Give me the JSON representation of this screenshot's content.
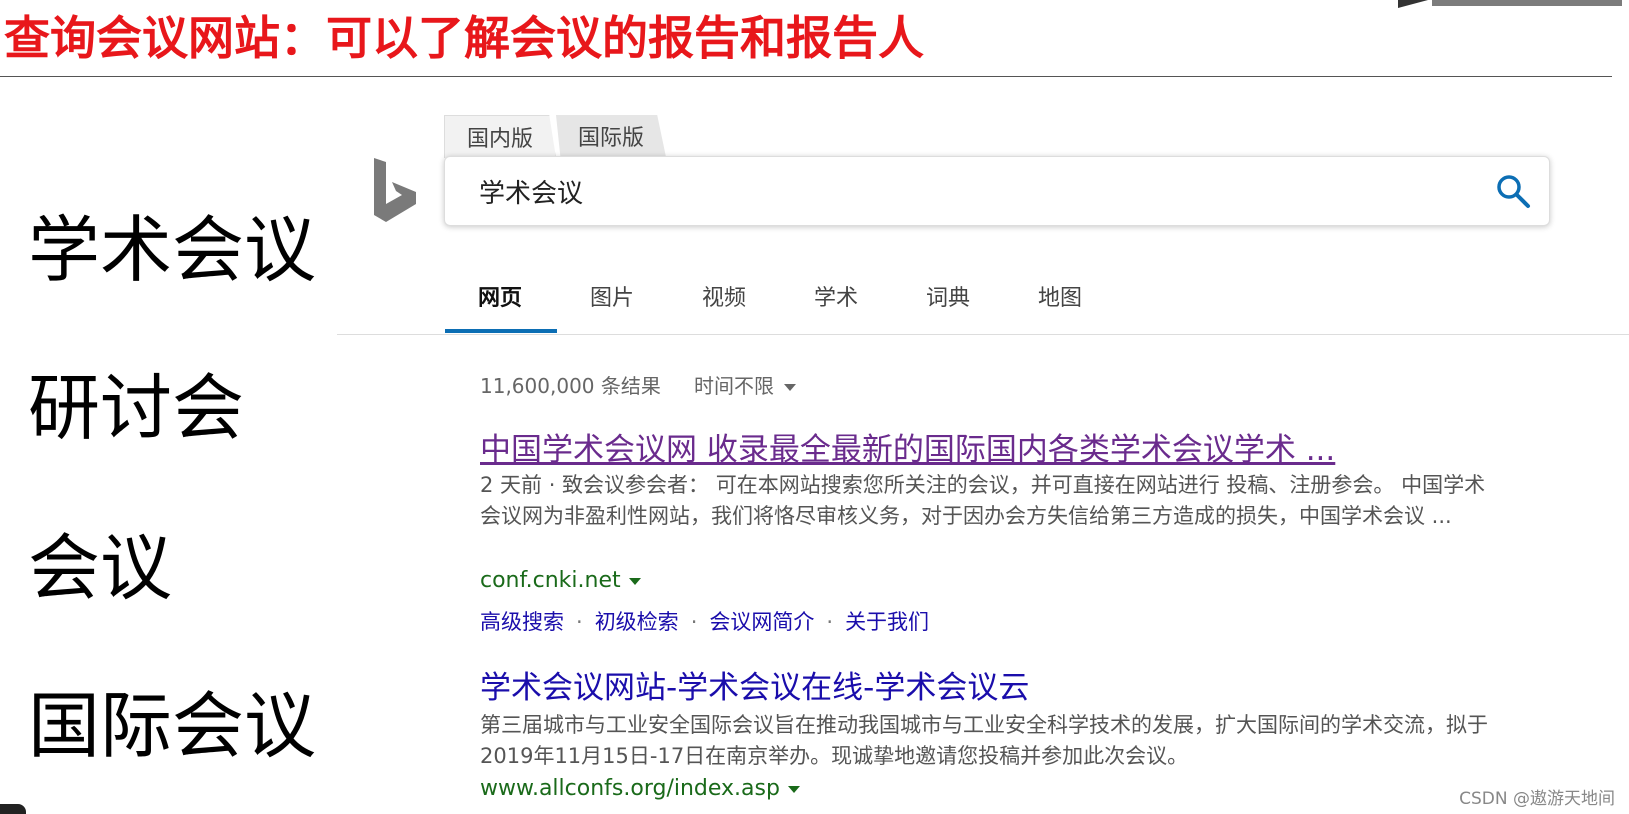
{
  "slide": {
    "title": "查询会议网站：可以了解会议的报告和报告人",
    "terms": [
      "学术会议",
      "研讨会",
      "会议",
      "国际会议"
    ]
  },
  "search": {
    "tabs": [
      "国内版",
      "国际版"
    ],
    "query": "学术会议",
    "nav": [
      "网页",
      "图片",
      "视频",
      "学术",
      "词典",
      "地图"
    ],
    "result_count": "11,600,000 条结果",
    "time_filter": "时间不限"
  },
  "results": [
    {
      "title": "中国学术会议网 收录最全最新的国际国内各类学术会议学术 ...",
      "snippet": "2 天前 · 致会议参会者： 可在本网站搜索您所关注的会议，并可直接在网站进行 投稿、注册参会。 中国学术会议网为非盈利性网站，我们将恪尽审核义务，对于因办会方失信给第三方造成的损失，中国学术会议 ...",
      "url": "conf.cnki.net",
      "links": [
        "高级搜索",
        "初级检索",
        "会议网简介",
        "关于我们"
      ]
    },
    {
      "title": "学术会议网站-学术会议在线-学术会议云",
      "snippet": "第三届城市与工业安全国际会议旨在推动我国城市与工业安全科学技术的发展，扩大国际间的学术交流，拟于2019年11月15日-17日在南京举办。现诚挚地邀请您投稿并参加此次会议。",
      "url": "www.allconfs.org/index.asp"
    }
  ],
  "watermark": "CSDN @遨游天地间",
  "colors": {
    "title_red": "#e8171b",
    "visited_link": "#6a2b8d",
    "link": "#1a0dab",
    "url_green": "#1a6a1a",
    "accent_blue": "#0c6eb4"
  }
}
